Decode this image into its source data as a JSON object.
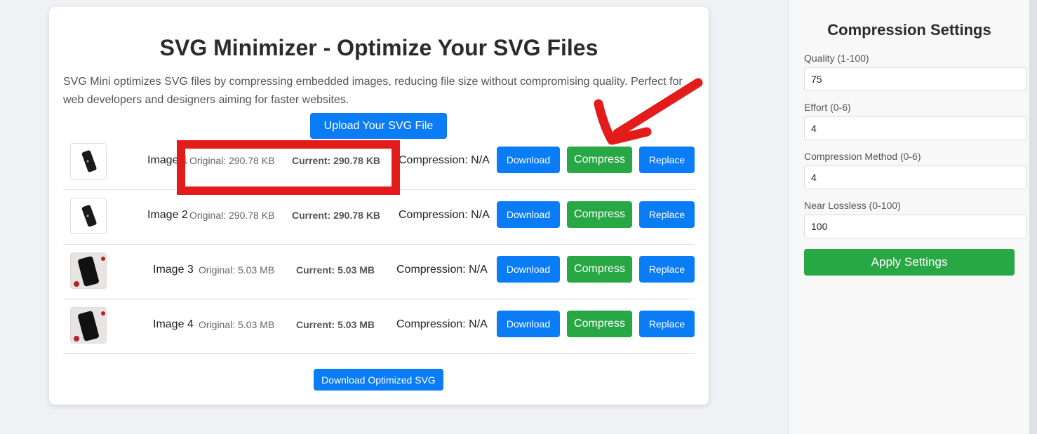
{
  "main": {
    "title": "SVG Minimizer - Optimize Your SVG Files",
    "description": "SVG Mini optimizes SVG files by compressing embedded images, reducing file size without compromising quality. Perfect for web developers and designers aiming for faster websites.",
    "upload_label": "Upload Your SVG File",
    "download_all_label": "Download Optimized SVG",
    "images": [
      {
        "name": "Image 1",
        "original": "Original: 290.78 KB",
        "current": "Current: 290.78 KB",
        "compression": "Compression: N/A",
        "thumb": "phone-case-icon"
      },
      {
        "name": "Image 2",
        "original": "Original: 290.78 KB",
        "current": "Current: 290.78 KB",
        "compression": "Compression: N/A",
        "thumb": "phone-case-icon"
      },
      {
        "name": "Image 3",
        "original": "Original: 5.03 MB",
        "current": "Current: 5.03 MB",
        "compression": "Compression: N/A",
        "thumb": "phone-photo"
      },
      {
        "name": "Image 4",
        "original": "Original: 5.03 MB",
        "current": "Current: 5.03 MB",
        "compression": "Compression: N/A",
        "thumb": "phone-photo"
      }
    ],
    "row_buttons": {
      "download": "Download",
      "compress": "Compress",
      "replace": "Replace"
    }
  },
  "settings": {
    "title": "Compression Settings",
    "fields": [
      {
        "label": "Quality (1-100)",
        "value": "75"
      },
      {
        "label": "Effort (0-6)",
        "value": "4"
      },
      {
        "label": "Compression Method (0-6)",
        "value": "4"
      },
      {
        "label": "Near Lossless (0-100)",
        "value": "100"
      }
    ],
    "apply_label": "Apply Settings"
  },
  "colors": {
    "primary": "#0a7cf5",
    "success": "#28a745",
    "annotation": "#e31b1b"
  }
}
